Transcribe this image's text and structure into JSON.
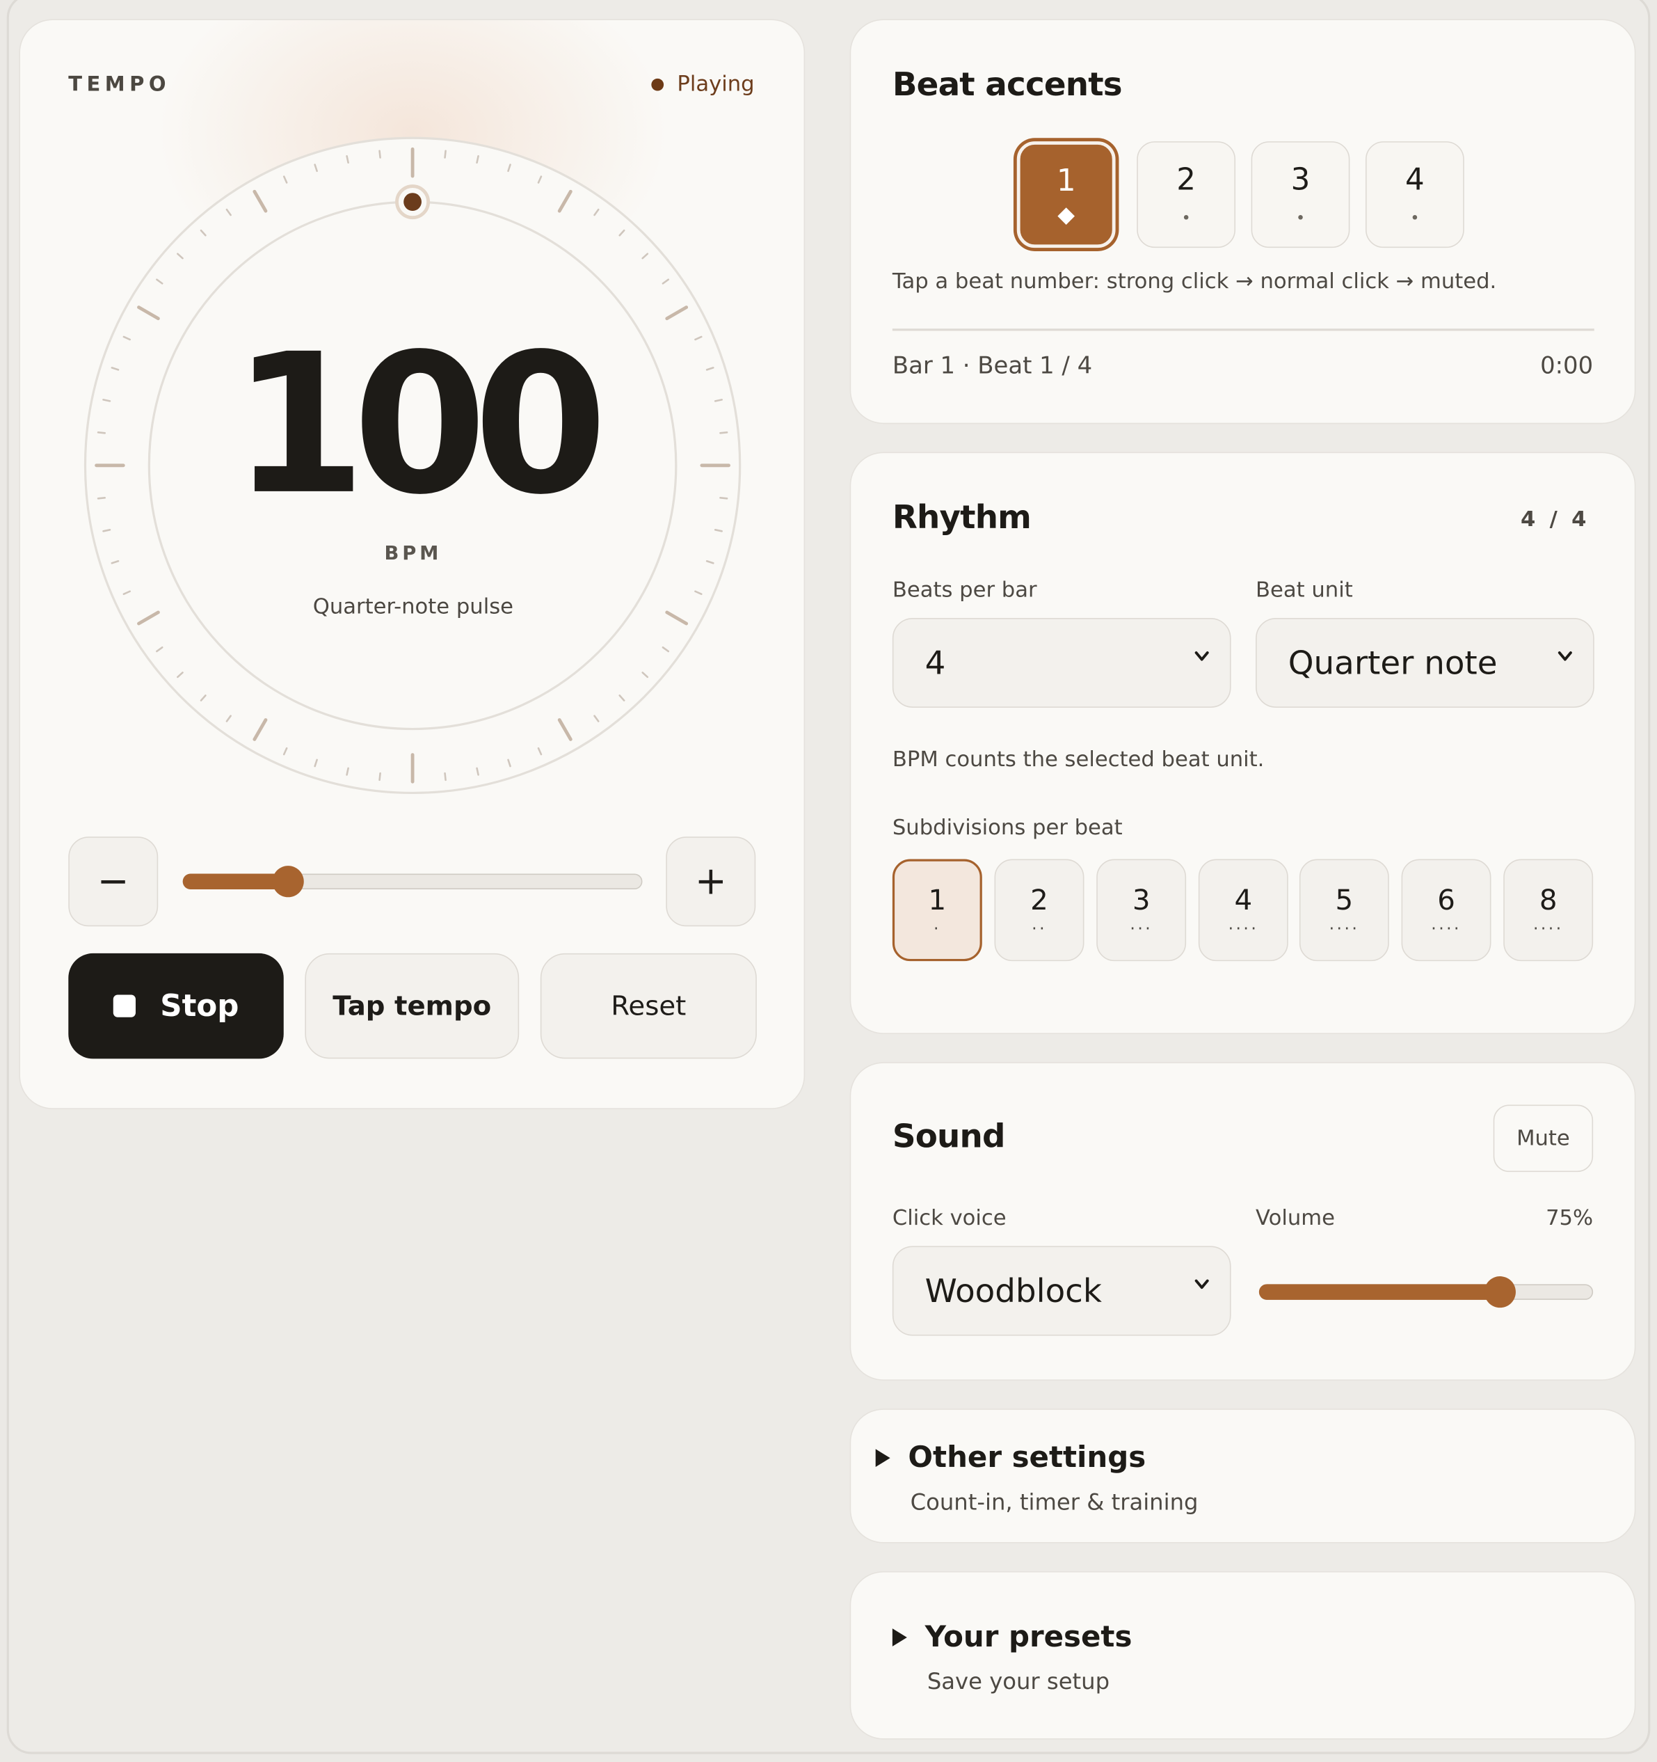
{
  "tempo": {
    "section_label": "TEMPO",
    "status": "Playing",
    "bpm": "100",
    "bpm_unit": "BPM",
    "pulse_label": "Quarter-note pulse",
    "minus": "−",
    "plus": "+",
    "slider_fraction": 0.23,
    "stop_label": "Stop",
    "tap_label": "Tap tempo",
    "reset_label": "Reset"
  },
  "accents": {
    "title": "Beat accents",
    "beats": [
      {
        "label": "1",
        "mark": "◆",
        "state": "strong"
      },
      {
        "label": "2",
        "mark": "•",
        "state": "normal"
      },
      {
        "label": "3",
        "mark": "•",
        "state": "normal"
      },
      {
        "label": "4",
        "mark": "•",
        "state": "normal"
      }
    ],
    "hint": "Tap a beat number: strong click → normal click → muted.",
    "position": "Bar 1 · Beat 1 / 4",
    "elapsed": "0:00"
  },
  "rhythm": {
    "title": "Rhythm",
    "time_signature": "4 / 4",
    "beats_per_bar_label": "Beats per bar",
    "beats_per_bar_value": "4",
    "beat_unit_label": "Beat unit",
    "beat_unit_value": "Quarter note",
    "note": "BPM counts the selected beat unit.",
    "subdivisions_label": "Subdivisions per beat",
    "subdivisions": [
      {
        "label": "1",
        "dots": "·"
      },
      {
        "label": "2",
        "dots": "··"
      },
      {
        "label": "3",
        "dots": "···"
      },
      {
        "label": "4",
        "dots": "····"
      },
      {
        "label": "5",
        "dots": "····"
      },
      {
        "label": "6",
        "dots": "····"
      },
      {
        "label": "8",
        "dots": "····"
      }
    ],
    "active_subdivision": "1"
  },
  "sound": {
    "title": "Sound",
    "mute_label": "Mute",
    "voice_label": "Click voice",
    "voice_value": "Woodblock",
    "volume_label": "Volume",
    "volume_value": "75%",
    "volume_fraction": 0.72
  },
  "other_settings": {
    "title": "Other settings",
    "subtitle": "Count-in, timer & training"
  },
  "presets": {
    "title": "Your presets",
    "subtitle": "Save your setup"
  },
  "colors": {
    "accent": "#a6622d",
    "dark": "#1d1b17",
    "card": "#faf9f6",
    "background": "#ebe9e5"
  }
}
